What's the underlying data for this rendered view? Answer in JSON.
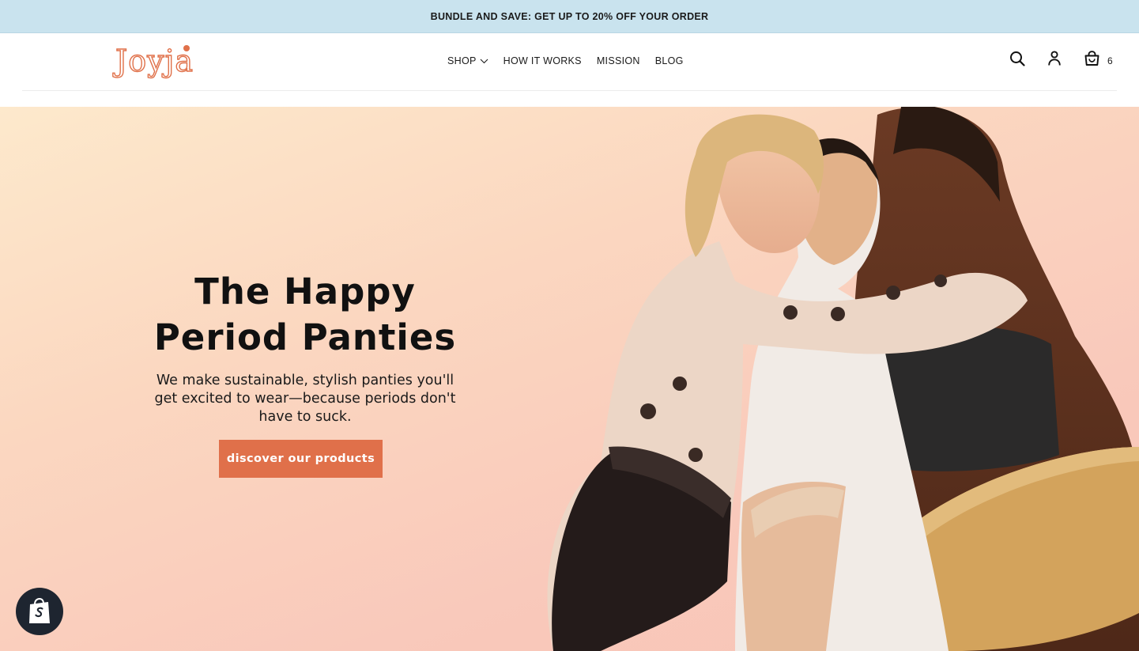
{
  "announcement": {
    "text": "BUNDLE AND SAVE: GET UP TO 20% OFF YOUR ORDER"
  },
  "header": {
    "logo_text": "Joyja",
    "nav": [
      {
        "label": "SHOP"
      },
      {
        "label": "HOW IT WORKS"
      },
      {
        "label": "MISSION"
      },
      {
        "label": "BLOG"
      }
    ],
    "cart_count": "6",
    "icons": [
      "search-icon",
      "account-icon",
      "cart-icon",
      "chevron-down-icon"
    ]
  },
  "hero": {
    "title_line1": "The Happy",
    "title_line2": "Period Panties",
    "subtitle": "We make sustainable, stylish panties you'll get excited to wear—because periods don't have to suck.",
    "cta_label": "discover our products"
  },
  "colors": {
    "announcement_bg": "#c9e3ee",
    "brand_orange": "#e0704a",
    "hero_bg_top": "#fde9cc",
    "hero_bg_bottom": "#f8c4b6",
    "text_dark": "#111111"
  }
}
